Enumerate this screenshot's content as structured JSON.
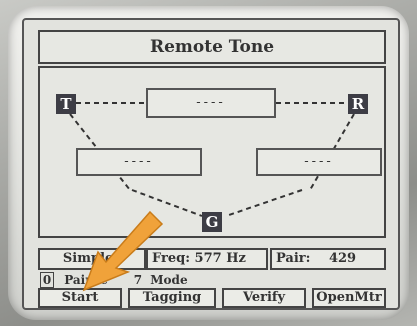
{
  "title": "Remote Tone",
  "nodes": {
    "test": "T",
    "remote": "R",
    "ground": "G"
  },
  "boxes": {
    "top": "----",
    "left": "----",
    "right": "----"
  },
  "status": {
    "mode": "Simplex",
    "freq_label": "Freq:",
    "freq_value": "577 Hz",
    "pair_label": "Pair:",
    "pair_value": "429"
  },
  "mode_row": {
    "number": "0",
    "label": "PairSc",
    "digit": "7",
    "suffix": "Mode"
  },
  "softkeys": [
    "Start",
    "Tagging",
    "Verify",
    "OpenMtr"
  ],
  "colors": {
    "arrow": "#f0a23a",
    "node": "#3d3d45"
  },
  "annotation": {
    "icon": "arrow-pointer-icon",
    "target": "Start"
  }
}
